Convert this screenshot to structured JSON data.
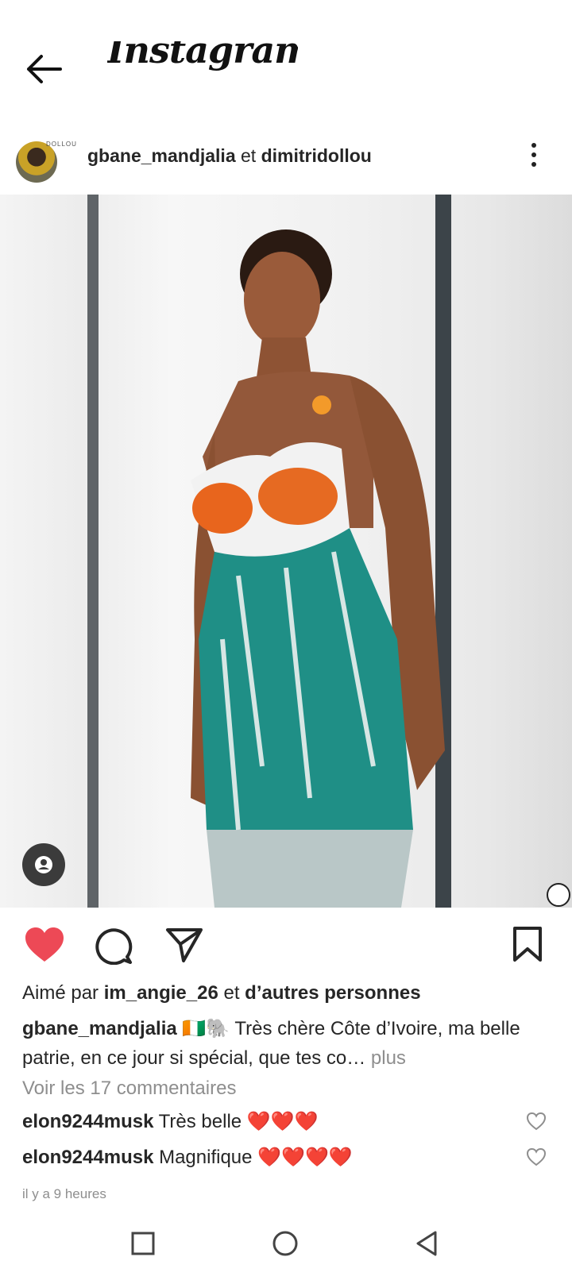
{
  "header": {
    "back_icon": "arrow-left-icon",
    "brand": "Instagram"
  },
  "post": {
    "avatar_tag": "DOLLOU",
    "author": "gbane_mandjalia",
    "conjunction": "et",
    "coauthor": "dimitridollou",
    "more_icon": "more-vertical-icon",
    "photo_tag_icon": "person-tag-icon",
    "watermark_icon": "photographer-logo-icon"
  },
  "actions": {
    "like_icon": "heart-filled-icon",
    "like_color": "#ed4956",
    "comment_icon": "comment-icon",
    "share_icon": "paper-plane-icon",
    "save_icon": "bookmark-icon"
  },
  "likes": {
    "prefix": "Aimé par",
    "user": "im_angie_26",
    "conj": "et",
    "others": "d’autres personnes"
  },
  "caption": {
    "author": "gbane_mandjalia",
    "text": " 🇨🇮🐘 Très chère Côte d’Ivoire, ma belle patrie, en ce jour si spécial, que tes co… ",
    "more": "plus"
  },
  "view_comments": "Voir les 17 commentaires",
  "comments": [
    {
      "user": "elon9244musk",
      "text": "Très belle ❤️❤️❤️",
      "like_icon": "heart-outline-icon"
    },
    {
      "user": "elon9244musk",
      "text": "Magnifique ❤️❤️❤️❤️",
      "like_icon": "heart-outline-icon"
    }
  ],
  "timestamp": "il y a 9 heures",
  "nav": {
    "recents_icon": "square-icon",
    "home_icon": "circle-icon",
    "back_icon": "triangle-back-icon"
  }
}
